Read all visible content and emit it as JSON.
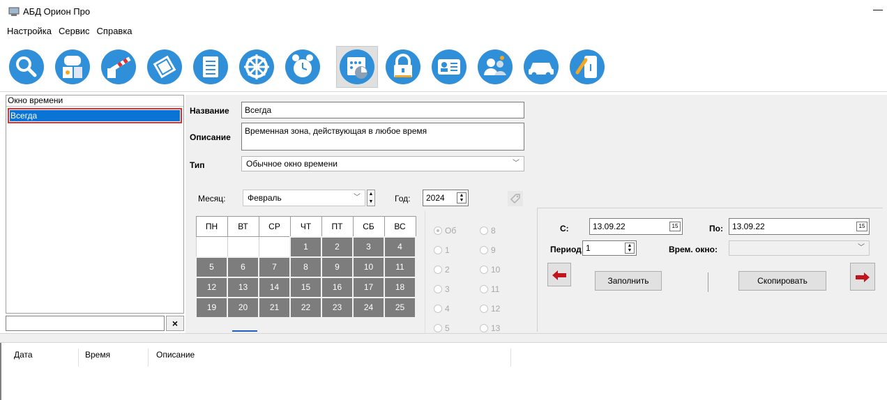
{
  "window": {
    "title": "АБД Орион Про",
    "minimize": "—"
  },
  "menu": [
    "Настройка",
    "Сервис",
    "Справка"
  ],
  "toolbar": {
    "icons": [
      "search-icon",
      "device-icon",
      "barrier-icon",
      "plan-icon",
      "document-icon",
      "wheel-icon",
      "clock-icon",
      "schedule-icon",
      "lock-icon",
      "card-icon",
      "users-icon",
      "car-icon",
      "key-icon"
    ],
    "active": "schedule-icon"
  },
  "list": {
    "header": "Окно времени",
    "selected_item": "Всегда",
    "search_value": "",
    "clear_label": "×"
  },
  "form": {
    "name_label": "Название",
    "name_value": "Всегда",
    "desc_label": "Описание",
    "desc_value": "Временная зона, действующая в любое время",
    "type_label": "Тип",
    "type_value": "Обычное окно времени"
  },
  "calendar": {
    "month_label": "Месяц:",
    "month_value": "Февраль",
    "year_label": "Год:",
    "year_value": "2024",
    "weekdays": [
      "ПН",
      "ВТ",
      "СР",
      "ЧТ",
      "ПТ",
      "СБ",
      "ВС"
    ],
    "rows": [
      [
        "",
        "",
        "",
        "1",
        "2",
        "3",
        "4"
      ],
      [
        "5",
        "6",
        "7",
        "8",
        "9",
        "10",
        "11"
      ],
      [
        "12",
        "13",
        "14",
        "15",
        "16",
        "17",
        "18"
      ],
      [
        "19",
        "20",
        "21",
        "22",
        "23",
        "24",
        "25"
      ]
    ],
    "today": "20"
  },
  "radios": {
    "col1": [
      "Об",
      "1",
      "2",
      "3",
      "4",
      "5"
    ],
    "col2": [
      "8",
      "9",
      "10",
      "11",
      "12",
      "13"
    ],
    "checked": "Об"
  },
  "period": {
    "from_label": "С:",
    "from_value": "13.09.22",
    "to_label": "По:",
    "to_value": "13.09.22",
    "period_label": "Период:",
    "period_value": "1",
    "window_label": "Врем. окно:",
    "window_value": "",
    "fill_label": "Заполнить",
    "copy_label": "Скопировать",
    "cal_icon_text": "15"
  },
  "log": {
    "columns": [
      "Дата",
      "Время",
      "Описание"
    ]
  },
  "colors": {
    "selection": "#0a74d6",
    "highlight_border": "#e03030",
    "day_cell": "#7d7d7d",
    "arrow": "#c0141e",
    "icon_blue": "#2f8fd8"
  }
}
